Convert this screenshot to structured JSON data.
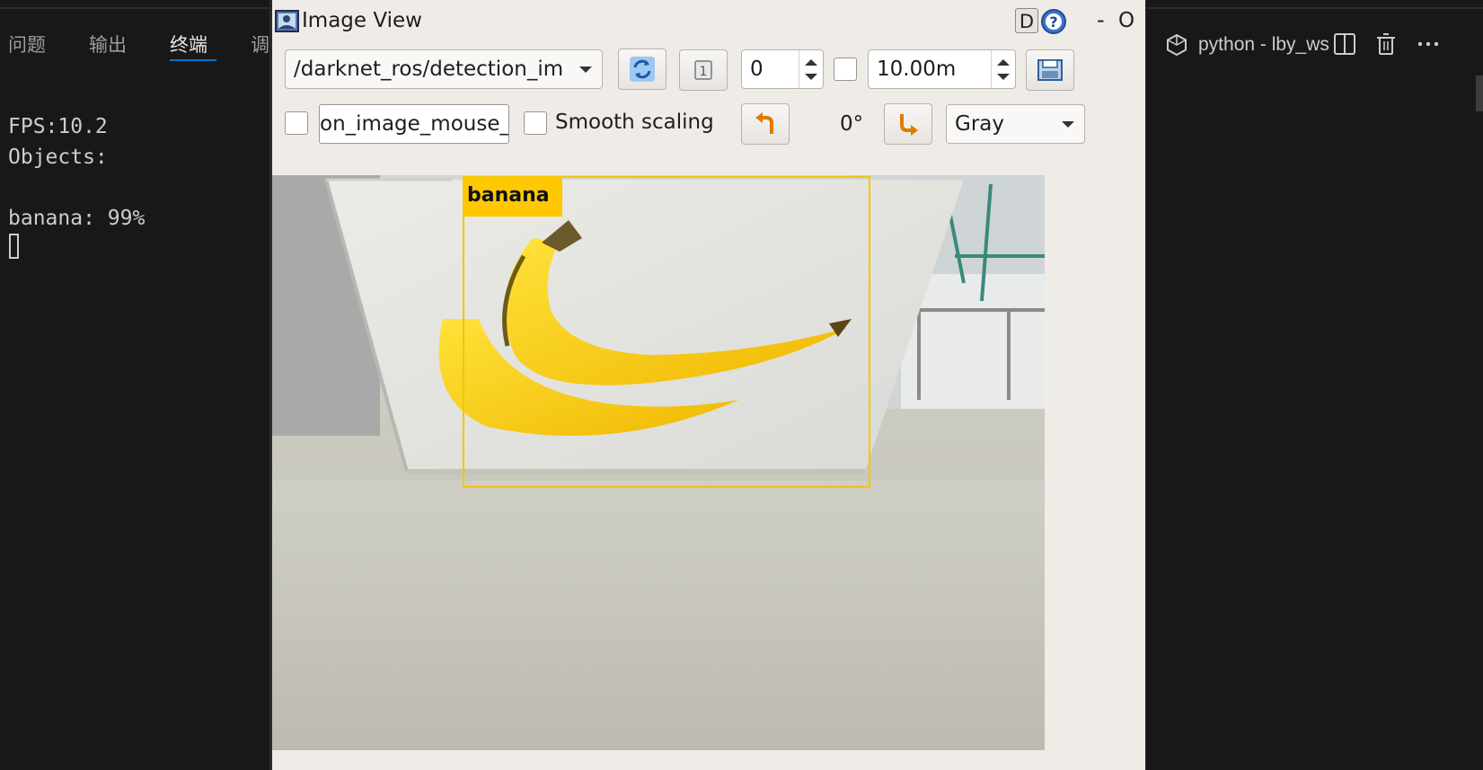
{
  "vscode": {
    "tabs": [
      "问题",
      "输出",
      "终端",
      "调"
    ],
    "active_tab": "终端",
    "terminal_lines": [
      "FPS:10.2",
      "Objects:",
      "",
      "banana: 99%"
    ],
    "terminal_entry": "python - lby_ws",
    "accent_color": "#0078d4",
    "icons": [
      "python-workspace-icon",
      "split-editor-icon",
      "trash-icon",
      "more-actions-icon"
    ]
  },
  "image_view": {
    "title": "Image View",
    "help_d": "D",
    "help_q_icon": "help-icon",
    "minimize": "-",
    "maximize": "O",
    "topic": "/darknet_ros/detection_im",
    "spin_value": "0",
    "duration": "10.00m",
    "mouse_topic": "on_image_mouse_",
    "smooth_scaling_label": "Smooth scaling",
    "smooth_scaling_checked": false,
    "rotation": "0°",
    "color_scheme": "Gray",
    "icons": [
      "refresh-icon",
      "zoom-1-icon",
      "save-icon",
      "rotate-left-icon",
      "rotate-right-icon"
    ]
  },
  "detection": {
    "label": "banana",
    "box_color": "#f2c600"
  }
}
